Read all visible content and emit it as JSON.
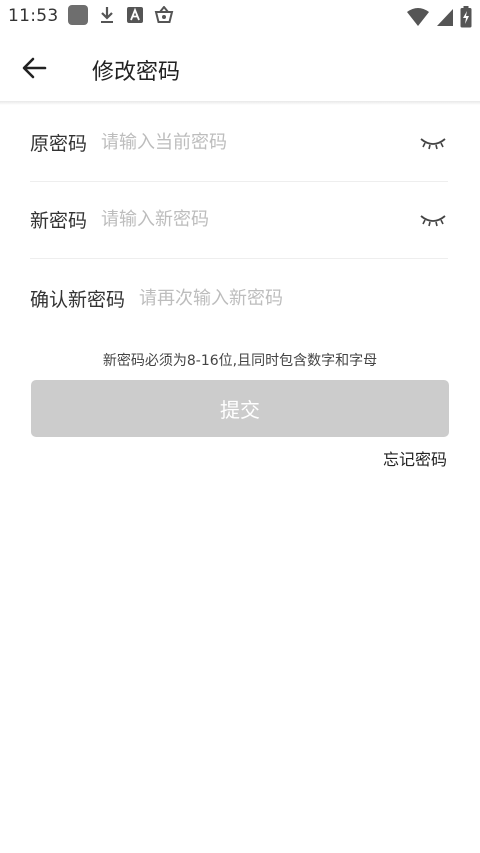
{
  "status_bar": {
    "time": "11:53",
    "left_icons": [
      "app-square-icon",
      "download-icon",
      "font-a-icon",
      "basket-icon"
    ],
    "right_icons": [
      "wifi-icon",
      "signal-icon",
      "battery-charging-icon"
    ]
  },
  "header": {
    "title": "修改密码",
    "back_icon": "arrow-left-icon"
  },
  "form": {
    "old_password": {
      "label": "原密码",
      "placeholder": "请输入当前密码",
      "value": "",
      "eye_icon": "eye-closed-icon"
    },
    "new_password": {
      "label": "新密码",
      "placeholder": "请输入新密码",
      "value": "",
      "eye_icon": "eye-closed-icon"
    },
    "confirm_password": {
      "label": "确认新密码",
      "placeholder": "请再次输入新密码",
      "value": ""
    },
    "hint": "新密码必须为8-16位,且同时包含数字和字母",
    "submit_label": "提交",
    "forgot_label": "忘记密码"
  },
  "colors": {
    "submit_disabled_bg": "#cccccc",
    "placeholder": "#bdbdbd",
    "divider": "#eeeeee"
  }
}
